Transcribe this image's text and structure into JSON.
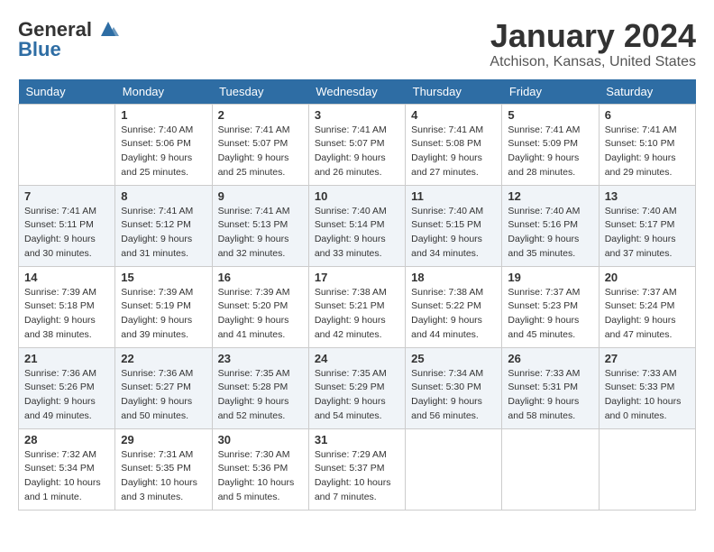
{
  "header": {
    "logo_line1": "General",
    "logo_line2": "Blue",
    "month": "January 2024",
    "location": "Atchison, Kansas, United States"
  },
  "weekdays": [
    "Sunday",
    "Monday",
    "Tuesday",
    "Wednesday",
    "Thursday",
    "Friday",
    "Saturday"
  ],
  "weeks": [
    [
      {
        "day": "",
        "sunrise": "",
        "sunset": "",
        "daylight": ""
      },
      {
        "day": "1",
        "sunrise": "Sunrise: 7:40 AM",
        "sunset": "Sunset: 5:06 PM",
        "daylight": "Daylight: 9 hours and 25 minutes."
      },
      {
        "day": "2",
        "sunrise": "Sunrise: 7:41 AM",
        "sunset": "Sunset: 5:07 PM",
        "daylight": "Daylight: 9 hours and 25 minutes."
      },
      {
        "day": "3",
        "sunrise": "Sunrise: 7:41 AM",
        "sunset": "Sunset: 5:07 PM",
        "daylight": "Daylight: 9 hours and 26 minutes."
      },
      {
        "day": "4",
        "sunrise": "Sunrise: 7:41 AM",
        "sunset": "Sunset: 5:08 PM",
        "daylight": "Daylight: 9 hours and 27 minutes."
      },
      {
        "day": "5",
        "sunrise": "Sunrise: 7:41 AM",
        "sunset": "Sunset: 5:09 PM",
        "daylight": "Daylight: 9 hours and 28 minutes."
      },
      {
        "day": "6",
        "sunrise": "Sunrise: 7:41 AM",
        "sunset": "Sunset: 5:10 PM",
        "daylight": "Daylight: 9 hours and 29 minutes."
      }
    ],
    [
      {
        "day": "7",
        "sunrise": "Sunrise: 7:41 AM",
        "sunset": "Sunset: 5:11 PM",
        "daylight": "Daylight: 9 hours and 30 minutes."
      },
      {
        "day": "8",
        "sunrise": "Sunrise: 7:41 AM",
        "sunset": "Sunset: 5:12 PM",
        "daylight": "Daylight: 9 hours and 31 minutes."
      },
      {
        "day": "9",
        "sunrise": "Sunrise: 7:41 AM",
        "sunset": "Sunset: 5:13 PM",
        "daylight": "Daylight: 9 hours and 32 minutes."
      },
      {
        "day": "10",
        "sunrise": "Sunrise: 7:40 AM",
        "sunset": "Sunset: 5:14 PM",
        "daylight": "Daylight: 9 hours and 33 minutes."
      },
      {
        "day": "11",
        "sunrise": "Sunrise: 7:40 AM",
        "sunset": "Sunset: 5:15 PM",
        "daylight": "Daylight: 9 hours and 34 minutes."
      },
      {
        "day": "12",
        "sunrise": "Sunrise: 7:40 AM",
        "sunset": "Sunset: 5:16 PM",
        "daylight": "Daylight: 9 hours and 35 minutes."
      },
      {
        "day": "13",
        "sunrise": "Sunrise: 7:40 AM",
        "sunset": "Sunset: 5:17 PM",
        "daylight": "Daylight: 9 hours and 37 minutes."
      }
    ],
    [
      {
        "day": "14",
        "sunrise": "Sunrise: 7:39 AM",
        "sunset": "Sunset: 5:18 PM",
        "daylight": "Daylight: 9 hours and 38 minutes."
      },
      {
        "day": "15",
        "sunrise": "Sunrise: 7:39 AM",
        "sunset": "Sunset: 5:19 PM",
        "daylight": "Daylight: 9 hours and 39 minutes."
      },
      {
        "day": "16",
        "sunrise": "Sunrise: 7:39 AM",
        "sunset": "Sunset: 5:20 PM",
        "daylight": "Daylight: 9 hours and 41 minutes."
      },
      {
        "day": "17",
        "sunrise": "Sunrise: 7:38 AM",
        "sunset": "Sunset: 5:21 PM",
        "daylight": "Daylight: 9 hours and 42 minutes."
      },
      {
        "day": "18",
        "sunrise": "Sunrise: 7:38 AM",
        "sunset": "Sunset: 5:22 PM",
        "daylight": "Daylight: 9 hours and 44 minutes."
      },
      {
        "day": "19",
        "sunrise": "Sunrise: 7:37 AM",
        "sunset": "Sunset: 5:23 PM",
        "daylight": "Daylight: 9 hours and 45 minutes."
      },
      {
        "day": "20",
        "sunrise": "Sunrise: 7:37 AM",
        "sunset": "Sunset: 5:24 PM",
        "daylight": "Daylight: 9 hours and 47 minutes."
      }
    ],
    [
      {
        "day": "21",
        "sunrise": "Sunrise: 7:36 AM",
        "sunset": "Sunset: 5:26 PM",
        "daylight": "Daylight: 9 hours and 49 minutes."
      },
      {
        "day": "22",
        "sunrise": "Sunrise: 7:36 AM",
        "sunset": "Sunset: 5:27 PM",
        "daylight": "Daylight: 9 hours and 50 minutes."
      },
      {
        "day": "23",
        "sunrise": "Sunrise: 7:35 AM",
        "sunset": "Sunset: 5:28 PM",
        "daylight": "Daylight: 9 hours and 52 minutes."
      },
      {
        "day": "24",
        "sunrise": "Sunrise: 7:35 AM",
        "sunset": "Sunset: 5:29 PM",
        "daylight": "Daylight: 9 hours and 54 minutes."
      },
      {
        "day": "25",
        "sunrise": "Sunrise: 7:34 AM",
        "sunset": "Sunset: 5:30 PM",
        "daylight": "Daylight: 9 hours and 56 minutes."
      },
      {
        "day": "26",
        "sunrise": "Sunrise: 7:33 AM",
        "sunset": "Sunset: 5:31 PM",
        "daylight": "Daylight: 9 hours and 58 minutes."
      },
      {
        "day": "27",
        "sunrise": "Sunrise: 7:33 AM",
        "sunset": "Sunset: 5:33 PM",
        "daylight": "Daylight: 10 hours and 0 minutes."
      }
    ],
    [
      {
        "day": "28",
        "sunrise": "Sunrise: 7:32 AM",
        "sunset": "Sunset: 5:34 PM",
        "daylight": "Daylight: 10 hours and 1 minute."
      },
      {
        "day": "29",
        "sunrise": "Sunrise: 7:31 AM",
        "sunset": "Sunset: 5:35 PM",
        "daylight": "Daylight: 10 hours and 3 minutes."
      },
      {
        "day": "30",
        "sunrise": "Sunrise: 7:30 AM",
        "sunset": "Sunset: 5:36 PM",
        "daylight": "Daylight: 10 hours and 5 minutes."
      },
      {
        "day": "31",
        "sunrise": "Sunrise: 7:29 AM",
        "sunset": "Sunset: 5:37 PM",
        "daylight": "Daylight: 10 hours and 7 minutes."
      },
      {
        "day": "",
        "sunrise": "",
        "sunset": "",
        "daylight": ""
      },
      {
        "day": "",
        "sunrise": "",
        "sunset": "",
        "daylight": ""
      },
      {
        "day": "",
        "sunrise": "",
        "sunset": "",
        "daylight": ""
      }
    ]
  ]
}
